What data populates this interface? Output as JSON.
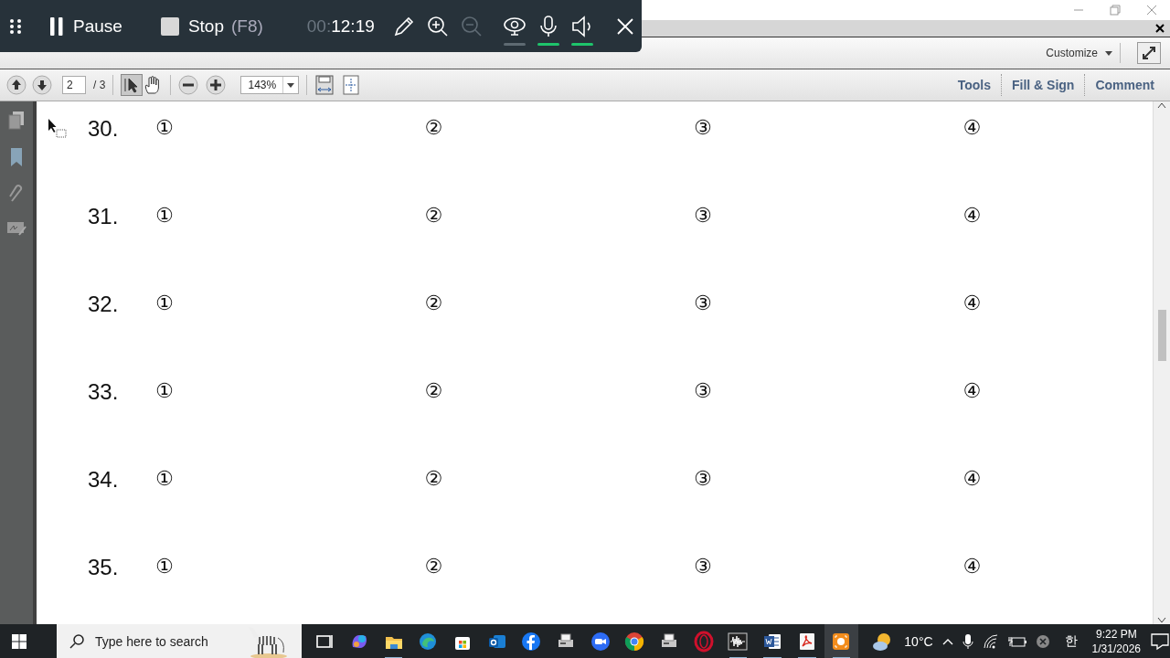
{
  "recorder": {
    "pause_label": "Pause",
    "stop_label": "Stop",
    "stop_shortcut": "(F8)",
    "elapsed_hours": "00:",
    "elapsed": "12:19",
    "zoom_out_disabled": true,
    "webcam_on": false,
    "mic_on": true,
    "speaker_on": true
  },
  "toolbar_top": {
    "customize_label": "Customize"
  },
  "toolbar_nav": {
    "page": "2",
    "page_total": "/ 3",
    "select_tool_selected": true,
    "zoom": "143%"
  },
  "panes": [
    {
      "label": "Tools",
      "selected": false
    },
    {
      "label": "Fill & Sign",
      "selected": false
    },
    {
      "label": "Comment",
      "selected": false
    }
  ],
  "questions": [
    {
      "number": "30.",
      "options": [
        "①",
        "②",
        "③",
        "④"
      ]
    },
    {
      "number": "31.",
      "options": [
        "①",
        "②",
        "③",
        "④"
      ]
    },
    {
      "number": "32.",
      "options": [
        "①",
        "②",
        "③",
        "④"
      ]
    },
    {
      "number": "33.",
      "options": [
        "①",
        "②",
        "③",
        "④"
      ]
    },
    {
      "number": "34.",
      "options": [
        "①",
        "②",
        "③",
        "④"
      ]
    },
    {
      "number": "35.",
      "options": [
        "①",
        "②",
        "③",
        "④"
      ]
    }
  ],
  "taskbar": {
    "search_placeholder": "Type here to search",
    "apps": [
      {
        "kind": "taskview",
        "running": false,
        "active": false
      },
      {
        "kind": "copilot",
        "running": false,
        "active": false
      },
      {
        "kind": "folder",
        "running": true,
        "active": false
      },
      {
        "kind": "edge",
        "running": false,
        "active": false
      },
      {
        "kind": "store",
        "running": false,
        "active": false
      },
      {
        "kind": "outlook",
        "running": false,
        "active": false
      },
      {
        "kind": "facebook",
        "running": false,
        "active": false
      },
      {
        "kind": "scanner",
        "running": false,
        "active": false
      },
      {
        "kind": "zoom",
        "running": false,
        "active": false
      },
      {
        "kind": "chrome",
        "running": false,
        "active": false
      },
      {
        "kind": "scanner",
        "running": false,
        "active": false
      },
      {
        "kind": "opera",
        "running": false,
        "active": false
      },
      {
        "kind": "audio",
        "running": true,
        "active": false
      },
      {
        "kind": "word",
        "running": true,
        "active": false
      },
      {
        "kind": "acrobat",
        "running": true,
        "active": false
      },
      {
        "kind": "recorder",
        "running": true,
        "active": true
      }
    ],
    "temperature": "10°C",
    "ime": "한",
    "time": "9:22 PM",
    "date": "1/31/2026"
  }
}
